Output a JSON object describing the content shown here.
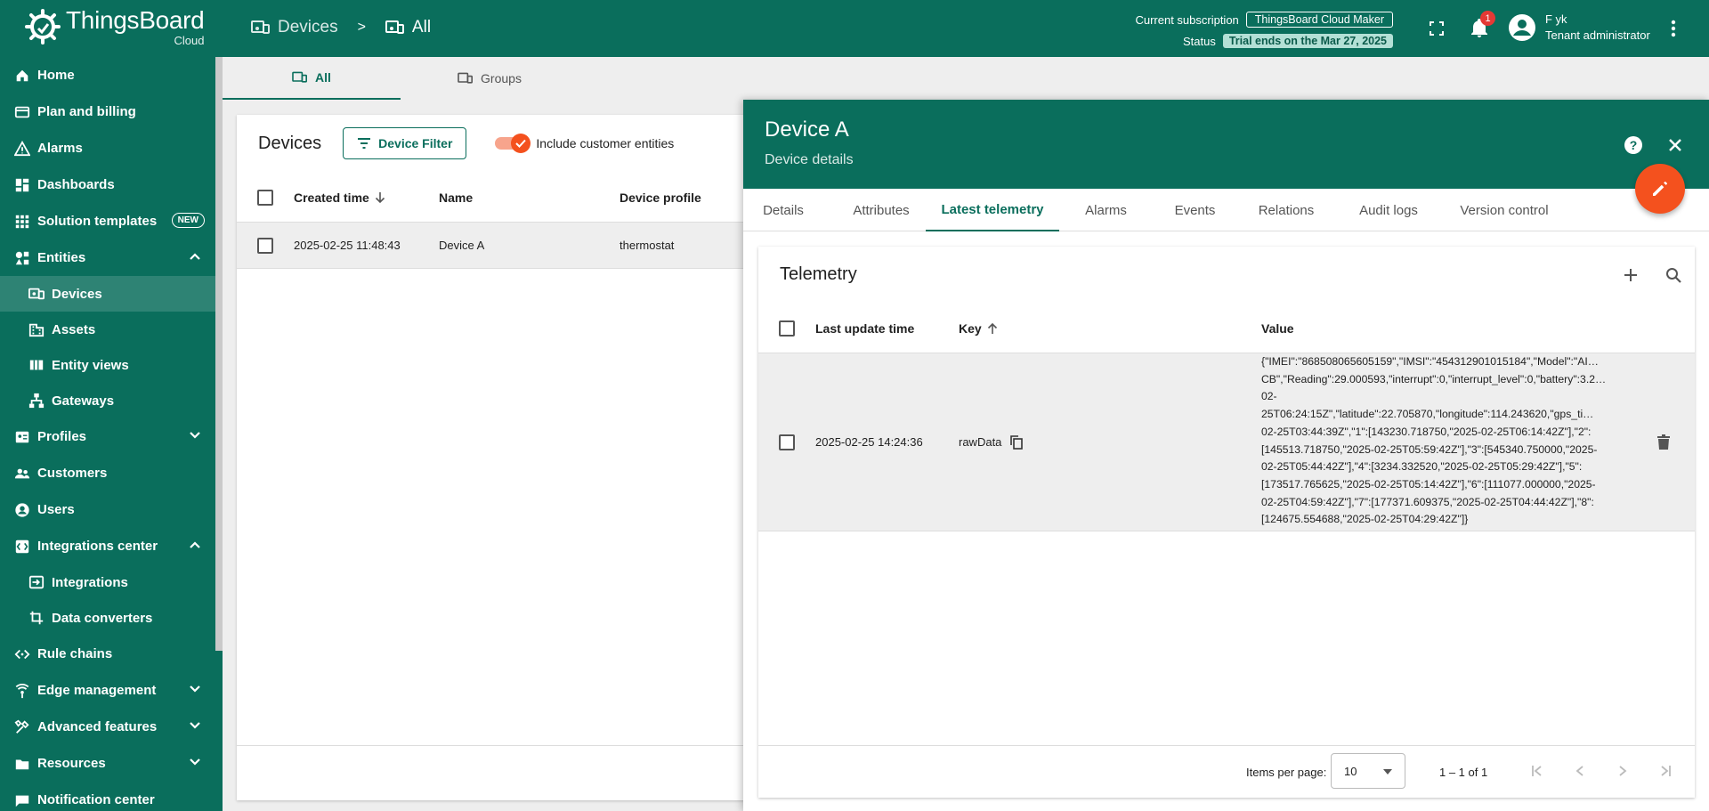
{
  "app": {
    "logo_title": "ThingsBoard",
    "logo_sub": "Cloud",
    "breadcrumb": [
      "Devices",
      ">",
      "All"
    ]
  },
  "topbar": {
    "subscription_label": "Current subscription",
    "subscription_value": "ThingsBoard Cloud Maker",
    "status_label": "Status",
    "status_value": "Trial ends on the Mar 27, 2025",
    "notification_count": "1",
    "user_name": "F yk",
    "user_role": "Tenant administrator"
  },
  "sidebar": {
    "items": [
      {
        "label": "Home",
        "icon": "home-icon"
      },
      {
        "label": "Plan and billing",
        "icon": "billing-icon"
      },
      {
        "label": "Alarms",
        "icon": "alarm-icon"
      },
      {
        "label": "Dashboards",
        "icon": "dashboard-icon"
      },
      {
        "label": "Solution templates",
        "icon": "templates-icon",
        "badge": "NEW"
      },
      {
        "label": "Entities",
        "icon": "entities-icon",
        "expanded": true
      },
      {
        "label": "Devices",
        "icon": "devices-icon",
        "sub": true,
        "active": true
      },
      {
        "label": "Assets",
        "icon": "assets-icon",
        "sub": true
      },
      {
        "label": "Entity views",
        "icon": "entity-views-icon",
        "sub": true
      },
      {
        "label": "Gateways",
        "icon": "gateways-icon",
        "sub": true
      },
      {
        "label": "Profiles",
        "icon": "profiles-icon"
      },
      {
        "label": "Customers",
        "icon": "customers-icon"
      },
      {
        "label": "Users",
        "icon": "users-icon"
      },
      {
        "label": "Integrations center",
        "icon": "integrations-center-icon",
        "expanded": true
      },
      {
        "label": "Integrations",
        "icon": "integrations-icon",
        "sub": true
      },
      {
        "label": "Data converters",
        "icon": "data-converters-icon",
        "sub": true
      },
      {
        "label": "Rule chains",
        "icon": "rule-chains-icon"
      },
      {
        "label": "Edge management",
        "icon": "edge-icon"
      },
      {
        "label": "Advanced features",
        "icon": "advanced-icon"
      },
      {
        "label": "Resources",
        "icon": "resources-icon"
      },
      {
        "label": "Notification center",
        "icon": "notification-center-icon"
      }
    ]
  },
  "main_tabs": [
    "All",
    "Groups"
  ],
  "devices": {
    "title": "Devices",
    "filter_label": "Device Filter",
    "toggle_label": "Include customer entities",
    "columns": [
      "Created time",
      "Name",
      "Device profile"
    ],
    "rows": [
      {
        "created": "2025-02-25 11:48:43",
        "name": "Device A",
        "profile": "thermostat"
      }
    ]
  },
  "detail": {
    "title": "Device A",
    "subtitle": "Device details",
    "tabs": [
      "Details",
      "Attributes",
      "Latest telemetry",
      "Alarms",
      "Events",
      "Relations",
      "Audit logs",
      "Version control"
    ],
    "active_tab": "Latest telemetry"
  },
  "telemetry": {
    "title": "Telemetry",
    "columns": [
      "Last update time",
      "Key",
      "Value"
    ],
    "rows": [
      {
        "time": "2025-02-25 14:24:36",
        "key": "rawData",
        "value_lines": [
          "{\"IMEI\":\"868508065605159\",\"IMSI\":\"454312901015184\",\"Model\":\"AI…",
          "CB\",\"Reading\":29.000593,\"interrupt\":0,\"interrupt_level\":0,\"battery\":3.2…",
          "02-",
          "25T06:24:15Z\",\"latitude\":22.705870,\"longitude\":114.243620,\"gps_ti…",
          "02-25T03:44:39Z\",\"1\":[143230.718750,\"2025-02-25T06:14:42Z\"],\"2\":",
          "[145513.718750,\"2025-02-25T05:59:42Z\"],\"3\":[545340.750000,\"2025-",
          "02-25T05:44:42Z\"],\"4\":[3234.332520,\"2025-02-25T05:29:42Z\"],\"5\":",
          "[173517.765625,\"2025-02-25T05:14:42Z\"],\"6\":[111077.000000,\"2025-",
          "02-25T04:59:42Z\"],\"7\":[177371.609375,\"2025-02-25T04:44:42Z\"],\"8\":",
          "[124675.554688,\"2025-02-25T04:29:42Z\"]}"
        ]
      }
    ],
    "items_per_page_label": "Items per page:",
    "items_per_page": "10",
    "range": "1 – 1 of 1"
  },
  "colors": {
    "primary": "#0a6e5c",
    "accent": "#f4511e"
  }
}
